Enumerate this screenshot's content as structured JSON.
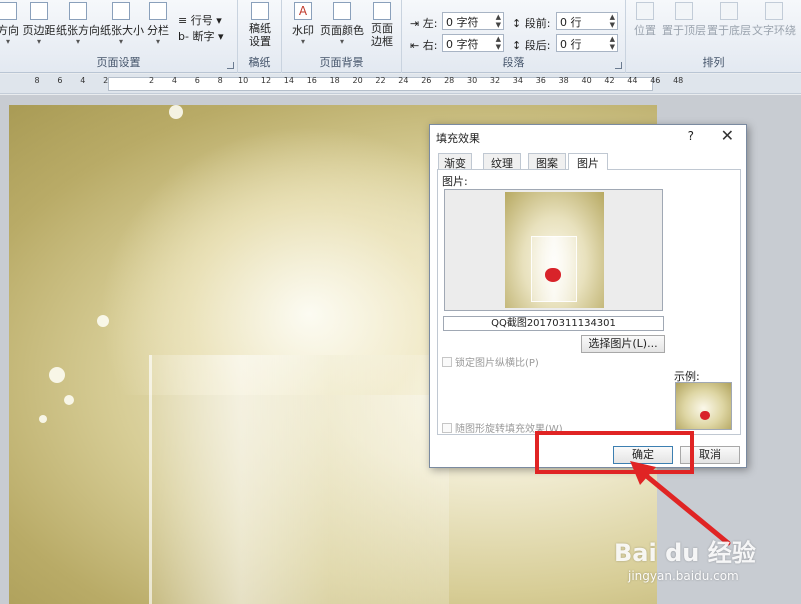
{
  "ribbon": {
    "page_setup": {
      "label": "页面设置",
      "buttons": [
        {
          "label": "方向"
        },
        {
          "label": "页边距"
        },
        {
          "label": "纸张方向"
        },
        {
          "label": "纸张大小"
        },
        {
          "label": "分栏"
        }
      ],
      "small": [
        "行号",
        "断字"
      ]
    },
    "manuscript": {
      "label": "稿纸",
      "button": "稿纸设置"
    },
    "background": {
      "label": "页面背景",
      "buttons": [
        {
          "label": "水印"
        },
        {
          "label": "页面颜色"
        },
        {
          "label": "页面边框"
        }
      ]
    },
    "paragraph": {
      "label": "段落",
      "left_label": "左:",
      "left_value": "0 字符",
      "right_label": "右:",
      "right_value": "0 字符",
      "before_label": "段前:",
      "before_value": "0 行",
      "after_label": "段后:",
      "after_value": "0 行"
    },
    "arrange": {
      "label": "排列",
      "buttons": [
        {
          "label": "位置"
        },
        {
          "label": "置于顶层"
        },
        {
          "label": "置于底层"
        },
        {
          "label": "文字环绕"
        }
      ]
    }
  },
  "ruler": {
    "ticks": [
      "8",
      "6",
      "4",
      "2",
      "",
      "2",
      "4",
      "6",
      "8",
      "10",
      "12",
      "14",
      "16",
      "18",
      "20",
      "22",
      "24",
      "26",
      "28",
      "30",
      "32",
      "34",
      "36",
      "38",
      "40",
      "42",
      "44",
      "46",
      "48"
    ]
  },
  "dialog": {
    "title": "填充效果",
    "help": "?",
    "close": "✕",
    "tabs": [
      {
        "label": "渐变"
      },
      {
        "label": "纹理"
      },
      {
        "label": "图案"
      },
      {
        "label": "图片"
      }
    ],
    "picture_label": "图片:",
    "file_name": "QQ截图20170311134301",
    "select_button": "选择图片(L)...",
    "lock_aspect": "锁定图片纵横比(P)",
    "rotate_with_shape": "随图形旋转填充效果(W)",
    "sample_label": "示例:",
    "ok_button": "确定",
    "cancel_button": "取消"
  },
  "watermark": {
    "main": "Bai du 经验",
    "sub": "jingyan.baidu.com"
  },
  "colors": {
    "annotation": "#e02424",
    "ribbon": "#e3e9f1"
  }
}
